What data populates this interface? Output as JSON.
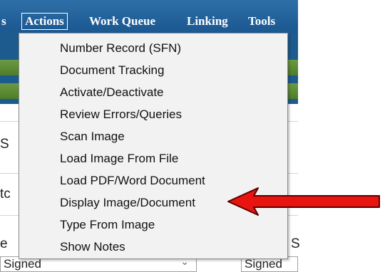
{
  "menubar": {
    "partial_label": "s",
    "items": [
      {
        "label": "Actions"
      },
      {
        "label": "Work Queue"
      },
      {
        "label": "Linking"
      },
      {
        "label": "Tools"
      }
    ]
  },
  "background": {
    "partial_texts": [
      "S",
      "tc",
      "e",
      "S"
    ],
    "field_left_value": "Signed",
    "field_right_value": "Signed"
  },
  "actions_menu": {
    "items": [
      {
        "label": "Number Record (SFN)"
      },
      {
        "label": "Document Tracking"
      },
      {
        "label": "Activate/Deactivate"
      },
      {
        "label": "Review Errors/Queries"
      },
      {
        "label": "Scan Image"
      },
      {
        "label": "Load Image From File"
      },
      {
        "label": "Load PDF/Word Document"
      },
      {
        "label": "Display Image/Document"
      },
      {
        "label": "Type From Image"
      },
      {
        "label": "Show Notes"
      }
    ]
  },
  "colors": {
    "menubar": "#1d5a93",
    "arrow": "#e8140f",
    "green_strip": "#5a8a35"
  }
}
